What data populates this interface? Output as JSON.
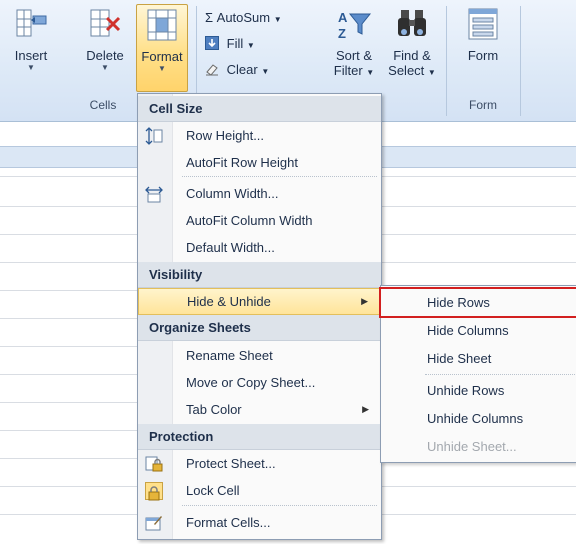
{
  "ribbon": {
    "cells_group": {
      "label": "Cells",
      "insert": "Insert",
      "delete": "Delete",
      "format": "Format"
    },
    "editing_group": {
      "autosum": "Σ AutoSum",
      "fill": "Fill",
      "clear": "Clear",
      "sort_filter_top": "Sort &",
      "sort_filter_bottom": "Filter",
      "find_select_top": "Find &",
      "find_select_bottom": "Select"
    },
    "form_group": {
      "label": "Form",
      "form": "Form"
    }
  },
  "format_menu": {
    "cell_size": {
      "header": "Cell Size",
      "items": [
        "Row Height...",
        "AutoFit Row Height",
        "Column Width...",
        "AutoFit Column Width",
        "Default Width..."
      ]
    },
    "visibility": {
      "header": "Visibility",
      "items": [
        "Hide & Unhide"
      ]
    },
    "organize": {
      "header": "Organize Sheets",
      "items": [
        "Rename Sheet",
        "Move or Copy Sheet...",
        "Tab Color"
      ]
    },
    "protection": {
      "header": "Protection",
      "items": [
        "Protect Sheet...",
        "Lock Cell",
        "Format Cells..."
      ]
    }
  },
  "hide_unhide_submenu": {
    "items": [
      "Hide Rows",
      "Hide Columns",
      "Hide Sheet",
      "Unhide Rows",
      "Unhide Columns",
      "Unhide Sheet..."
    ],
    "highlighted": "Hide Rows",
    "disabled": "Unhide Sheet..."
  },
  "colors": {
    "highlight_box": "#d21f1f",
    "menu_hover": "#ffe49a"
  }
}
